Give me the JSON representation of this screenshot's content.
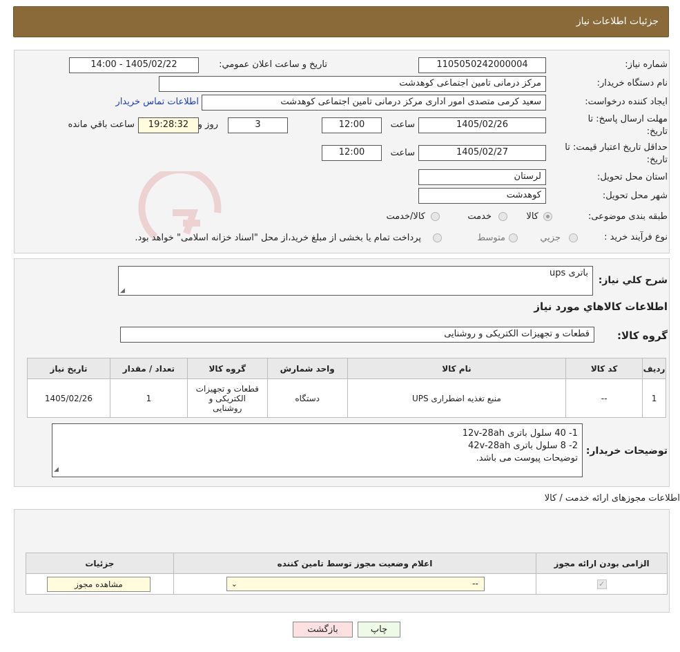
{
  "header": {
    "title": "جزئیات اطلاعات نیاز"
  },
  "form": {
    "need_number_label": "شماره نیاز:",
    "need_number": "1105050242000004",
    "announce_label": "تاريخ و ساعت اعلان عمومي:",
    "announce_value": "1405/02/22 - 14:00",
    "buyer_org_label": "نام دستگاه خريدار:",
    "buyer_org": "مرکز درمانی تامین اجتماعی کوهدشت",
    "requester_label": "ایجاد کننده درخواست:",
    "requester": "سعید کرمی متصدی امور اداری مرکز درمانی تامین اجتماعی کوهدشت",
    "contact_link": "اطلاعات تماس خريدار",
    "deadline_label_1": "مهلت ارسال پاسخ: تا",
    "deadline_label_2": "تاريخ:",
    "deadline_date": "1405/02/26",
    "time_label": "ساعت",
    "deadline_time": "12:00",
    "days_value": "3",
    "days_label": "روز و",
    "remaining_time": "19:28:32",
    "remaining_label": "ساعت باقي مانده",
    "validity_label_1": "حداقل تاريخ اعتبار قيمت: تا",
    "validity_label_2": "تاريخ:",
    "validity_date": "1405/02/27",
    "validity_time": "12:00",
    "province_label": "استان محل تحویل:",
    "province": "لرستان",
    "city_label": "شهر محل تحویل:",
    "city": "کوهدشت",
    "category_label": "طبقه بندی موضوعی:",
    "category_options": [
      "کالا",
      "خدمت",
      "کالا/خدمت"
    ],
    "process_label": "نوع فرآيند خريد :",
    "process_options": [
      "جزيي",
      "متوسط"
    ],
    "process_note": "پرداخت تمام يا بخشی از مبلغ خريد،از محل \"اسناد خزانه اسلامی\" خواهد بود."
  },
  "items_section": {
    "desc_label": "شرح کلي نياز:",
    "desc_value": "باتری ups",
    "goods_info_title": "اطلاعات کالاهاي مورد نياز",
    "group_label": "گروه کالا:",
    "group_value": "قطعات و تجهیزات الکتریکی و روشنایی",
    "table_headers": [
      "رديف",
      "کد کالا",
      "نام کالا",
      "واحد شمارش",
      "گروه کالا",
      "تعداد / مقدار",
      "تاريخ نياز"
    ],
    "rows": [
      {
        "row": "1",
        "code": "--",
        "name": "منبع تغذیه اضطراری UPS",
        "unit": "دستگاه",
        "group": "قطعات و تجهیزات الکتریکی و روشنایی",
        "qty": "1",
        "date": "1405/02/26"
      }
    ],
    "buyer_notes_label": "توضيحات خريدار:",
    "buyer_notes": [
      "1- 40 سلول باتری 12v-28ah",
      "2- 8 سلول باتری 42v-28ah",
      "توضیحات پیوست می باشد."
    ]
  },
  "permits": {
    "title": "اطلاعات مجوزهای ارائه خدمت / کالا",
    "headers": [
      "الزامی بودن ارائه مجوز",
      "اعلام وضعیت مجوز توسط تامین کننده",
      "جزئیات"
    ],
    "select_value": "--",
    "view_button": "مشاهده مجوز"
  },
  "buttons": {
    "print": "چاپ",
    "back": "بازگشت"
  },
  "colors": {
    "header_bg": "#8b6a3a",
    "link": "#1a3cc8",
    "back_button_bg": "#fde0e0",
    "print_button_bg": "#edfbe6"
  }
}
